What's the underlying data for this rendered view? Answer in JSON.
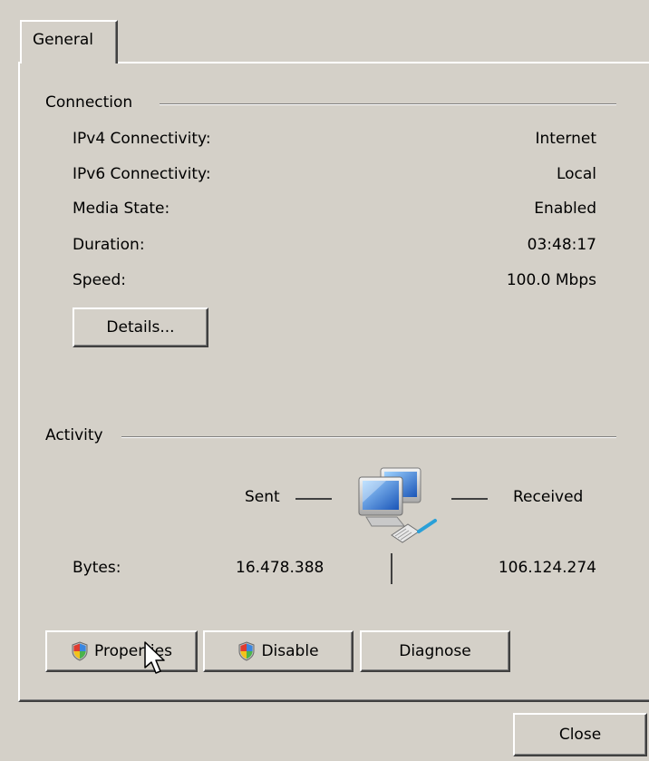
{
  "tabs": [
    {
      "label": "General",
      "selected": true
    }
  ],
  "connection": {
    "title": "Connection",
    "rows": [
      {
        "label": "IPv4 Connectivity:",
        "value": "Internet"
      },
      {
        "label": "IPv6 Connectivity:",
        "value": "Local"
      },
      {
        "label": "Media State:",
        "value": "Enabled"
      },
      {
        "label": "Duration:",
        "value": "03:48:17"
      },
      {
        "label": "Speed:",
        "value": "100.0 Mbps"
      }
    ],
    "details_button": "Details..."
  },
  "activity": {
    "title": "Activity",
    "sent_label": "Sent",
    "received_label": "Received",
    "bytes_label": "Bytes:",
    "bytes_sent": "16.478.388",
    "bytes_received": "106.124.274"
  },
  "buttons": {
    "properties": "Properties",
    "disable": "Disable",
    "diagnose": "Diagnose",
    "close": "Close"
  },
  "icons": {
    "network": "network-computers-icon",
    "shield": "uac-shield-icon",
    "cursor": "mouse-pointer-icon"
  },
  "colors": {
    "face": "#d4d0c8",
    "highlight": "#ffffff",
    "shadow": "#808080",
    "dark_shadow": "#404040"
  }
}
